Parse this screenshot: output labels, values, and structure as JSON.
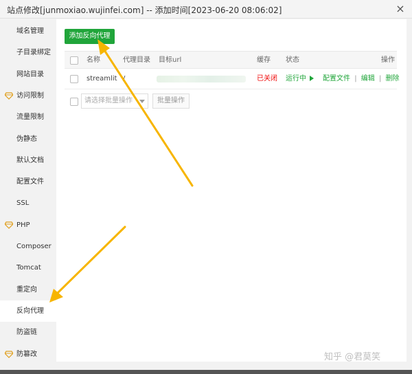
{
  "window": {
    "title": "站点修改[junmoxiao.wujinfei.com] -- 添加时间[2023-06-20 08:06:02]",
    "close_glyph": "×"
  },
  "sidebar": {
    "items": [
      {
        "label": "域名管理",
        "premium": false,
        "active": false
      },
      {
        "label": "子目录绑定",
        "premium": false,
        "active": false
      },
      {
        "label": "网站目录",
        "premium": false,
        "active": false
      },
      {
        "label": "访问限制",
        "premium": true,
        "active": false
      },
      {
        "label": "流量限制",
        "premium": false,
        "active": false
      },
      {
        "label": "伪静态",
        "premium": false,
        "active": false
      },
      {
        "label": "默认文档",
        "premium": false,
        "active": false
      },
      {
        "label": "配置文件",
        "premium": false,
        "active": false
      },
      {
        "label": "SSL",
        "premium": false,
        "active": false
      },
      {
        "label": "PHP",
        "premium": true,
        "active": false
      },
      {
        "label": "Composer",
        "premium": false,
        "active": false
      },
      {
        "label": "Tomcat",
        "premium": false,
        "active": false
      },
      {
        "label": "重定向",
        "premium": false,
        "active": false
      },
      {
        "label": "反向代理",
        "premium": false,
        "active": true
      },
      {
        "label": "防盗链",
        "premium": false,
        "active": false
      },
      {
        "label": "防篡改",
        "premium": true,
        "active": false
      }
    ]
  },
  "main": {
    "add_button": "添加反向代理",
    "table": {
      "headers": {
        "name": "名称",
        "proxy_dir": "代理目录",
        "target_url": "目标url",
        "cache": "缓存",
        "status": "状态",
        "actions": "操作"
      },
      "rows": [
        {
          "name": "streamlit",
          "proxy_dir": "/",
          "cache": "已关闭",
          "status": "运行中",
          "status_icon": "play-icon",
          "action_config": "配置文件",
          "action_edit": "编辑",
          "action_delete": "删除",
          "separator": "|"
        }
      ]
    },
    "batch": {
      "select_placeholder": "请选择批量操作",
      "button": "批量操作"
    }
  },
  "watermark": "知乎 @君莫笑",
  "colors": {
    "accent_green": "#20a53a",
    "closed_red": "#ef0808",
    "arrow_yellow": "#f7b500",
    "premium_gem": "#e0a020"
  }
}
